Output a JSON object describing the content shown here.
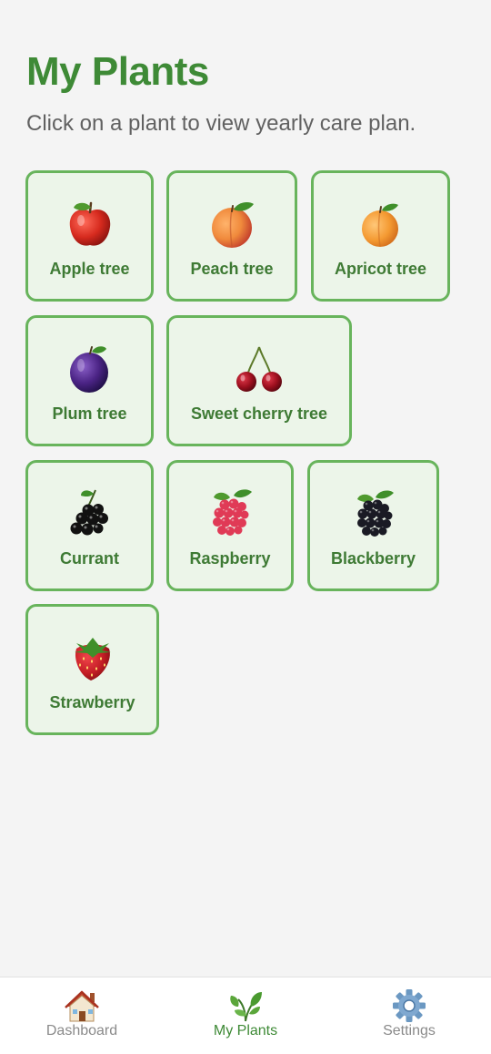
{
  "header": {
    "title": "My Plants",
    "subtitle": "Click on a plant to view yearly care plan."
  },
  "plants": [
    {
      "label": "Apple tree",
      "icon": "apple-icon"
    },
    {
      "label": "Peach tree",
      "icon": "peach-icon"
    },
    {
      "label": "Apricot tree",
      "icon": "apricot-icon"
    },
    {
      "label": "Plum tree",
      "icon": "plum-icon"
    },
    {
      "label": "Sweet cherry tree",
      "icon": "cherry-icon"
    },
    {
      "label": "Currant",
      "icon": "currant-icon"
    },
    {
      "label": "Raspberry",
      "icon": "raspberry-icon"
    },
    {
      "label": "Blackberry",
      "icon": "blackberry-icon"
    },
    {
      "label": "Strawberry",
      "icon": "strawberry-icon"
    }
  ],
  "nav": {
    "items": [
      {
        "label": "Dashboard",
        "icon": "house-icon",
        "active": false
      },
      {
        "label": "My Plants",
        "icon": "leaf-icon",
        "active": true
      },
      {
        "label": "Settings",
        "icon": "gear-icon",
        "active": false
      }
    ]
  },
  "colors": {
    "accent": "#3e8a36",
    "tile_border": "#68b45c",
    "tile_background": "#ecf5e9",
    "background": "#f4f4f4"
  }
}
